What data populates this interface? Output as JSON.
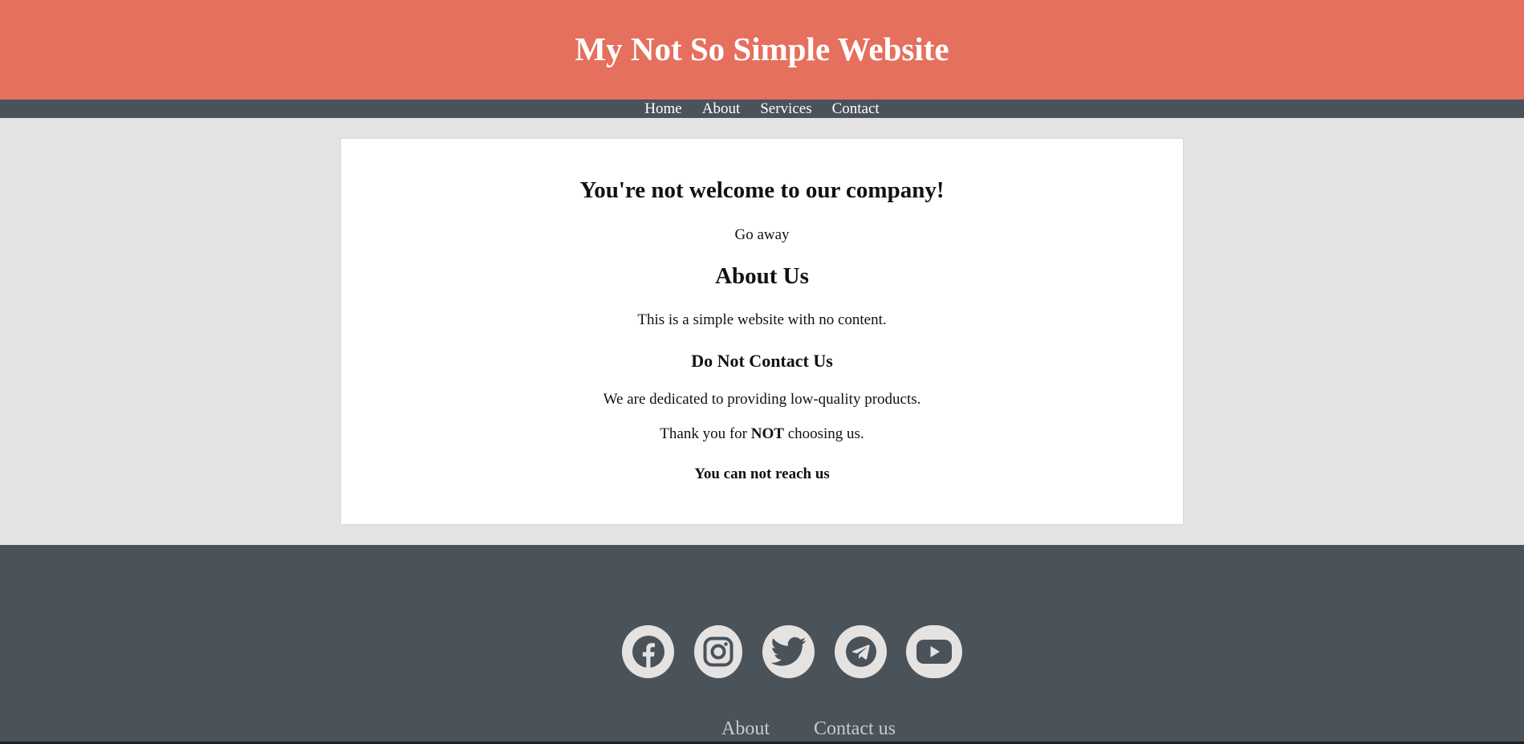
{
  "header": {
    "title": "My Not So Simple Website"
  },
  "nav": {
    "items": [
      "Home",
      "About",
      "Services",
      "Contact"
    ]
  },
  "main": {
    "welcome_heading": "You're not welcome to our company!",
    "welcome_text": "Go away",
    "about_heading": "About Us",
    "about_text": "This is a simple website with no content.",
    "contact_heading": "Do Not Contact Us",
    "dedication_text": "We are dedicated to providing low-quality products.",
    "thanks_prefix": "Thank you for ",
    "thanks_emphasis": "NOT",
    "thanks_suffix": " choosing us.",
    "reach_text": "You can not reach us"
  },
  "footer": {
    "social": [
      "facebook-icon",
      "instagram-icon",
      "twitter-icon",
      "telegram-icon",
      "youtube-icon"
    ],
    "links": [
      "About",
      "Contact us"
    ]
  },
  "colors": {
    "header_bg": "#e5705d",
    "nav_bg": "#4a525a",
    "page_bg": "#e4e3e1",
    "card_bg": "#ffffff",
    "footer_bg": "#4a525a",
    "icon_circle": "#e4e3e1",
    "icon_glyph": "#4a525a"
  }
}
